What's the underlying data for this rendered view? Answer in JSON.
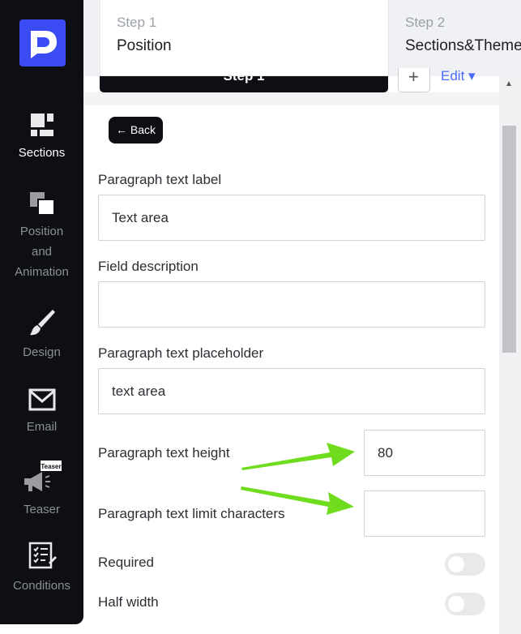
{
  "sidebar": {
    "items": [
      {
        "label": "Sections",
        "icon": "sections-icon",
        "active": true
      },
      {
        "label_lines": [
          "Position",
          "and",
          "Animation"
        ],
        "icon": "position-icon",
        "active": false
      },
      {
        "label": "Design",
        "icon": "brush-icon",
        "active": false
      },
      {
        "label": "Email",
        "icon": "envelope-icon",
        "active": false
      },
      {
        "label": "Teaser",
        "icon": "megaphone-icon",
        "badge": "Teaser",
        "active": false
      },
      {
        "label": "Conditions",
        "icon": "checklist-icon",
        "active": false
      }
    ]
  },
  "steps": {
    "tabs": [
      {
        "num": "Step 1",
        "name": "Position"
      },
      {
        "num": "Step 2",
        "name": "Sections&Theme"
      }
    ],
    "bar_label": "Step 1",
    "plus_label": "+",
    "edit_label": "Edit ▾"
  },
  "form": {
    "back_label": "← Back",
    "paragraph_label": {
      "label": "Paragraph text label",
      "value": "Text area"
    },
    "field_description": {
      "label": "Field description",
      "value": ""
    },
    "placeholder": {
      "label": "Paragraph text placeholder",
      "value": "text area"
    },
    "height": {
      "label": "Paragraph text height",
      "value": "80"
    },
    "limit": {
      "label": "Paragraph text limit characters",
      "value": ""
    },
    "required": {
      "label": "Required",
      "on": false
    },
    "half_width": {
      "label": "Half width",
      "on": false
    }
  },
  "colors": {
    "sidebar_bg": "#0d0f14",
    "accent": "#4a6cf7",
    "arrow": "#6fdc1d"
  }
}
